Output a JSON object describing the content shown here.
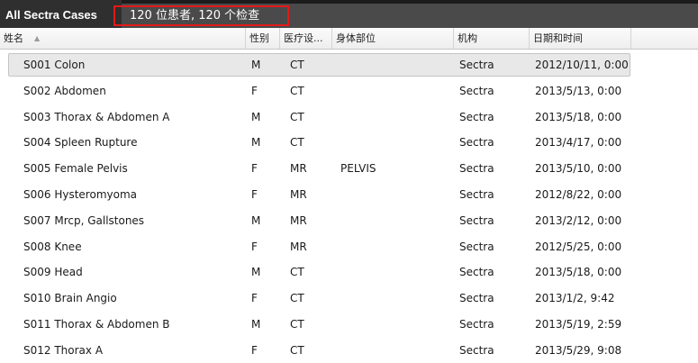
{
  "app": {
    "title": "All Sectra Cases",
    "case_count": "120 位患者, 120 个检查"
  },
  "columns": [
    {
      "key": "name",
      "label": "姓名"
    },
    {
      "key": "sex",
      "label": "性别"
    },
    {
      "key": "modality",
      "label": "医疗设..."
    },
    {
      "key": "body_part",
      "label": "身体部位"
    },
    {
      "key": "institution",
      "label": "机构"
    },
    {
      "key": "datetime",
      "label": "日期和时间"
    }
  ],
  "sort": {
    "column": "name",
    "direction": "ascending",
    "icon": "sort-ascending-icon"
  },
  "rows": [
    {
      "name": "S001 Colon",
      "sex": "M",
      "modality": "CT",
      "body_part": "",
      "institution": "Sectra",
      "datetime": "2012/10/11, 0:00",
      "selected": true
    },
    {
      "name": "S002 Abdomen",
      "sex": "F",
      "modality": "CT",
      "body_part": "",
      "institution": "Sectra",
      "datetime": "2013/5/13, 0:00"
    },
    {
      "name": "S003 Thorax & Abdomen A",
      "sex": "M",
      "modality": "CT",
      "body_part": "",
      "institution": "Sectra",
      "datetime": "2013/5/18, 0:00"
    },
    {
      "name": "S004 Spleen Rupture",
      "sex": "M",
      "modality": "CT",
      "body_part": "",
      "institution": "Sectra",
      "datetime": "2013/4/17, 0:00"
    },
    {
      "name": "S005 Female Pelvis",
      "sex": "F",
      "modality": "MR",
      "body_part": "PELVIS",
      "institution": "Sectra",
      "datetime": "2013/5/10, 0:00"
    },
    {
      "name": "S006 Hysteromyoma",
      "sex": "F",
      "modality": "MR",
      "body_part": "",
      "institution": "Sectra",
      "datetime": "2012/8/22, 0:00"
    },
    {
      "name": "S007 Mrcp, Gallstones",
      "sex": "M",
      "modality": "MR",
      "body_part": "",
      "institution": "Sectra",
      "datetime": "2013/2/12, 0:00"
    },
    {
      "name": "S008 Knee",
      "sex": "F",
      "modality": "MR",
      "body_part": "",
      "institution": "Sectra",
      "datetime": "2012/5/25, 0:00"
    },
    {
      "name": "S009 Head",
      "sex": "M",
      "modality": "CT",
      "body_part": "",
      "institution": "Sectra",
      "datetime": "2013/5/18, 0:00"
    },
    {
      "name": "S010 Brain Angio",
      "sex": "F",
      "modality": "CT",
      "body_part": "",
      "institution": "Sectra",
      "datetime": "2013/1/2, 9:42"
    },
    {
      "name": "S011 Thorax & Abdomen B",
      "sex": "M",
      "modality": "CT",
      "body_part": "",
      "institution": "Sectra",
      "datetime": "2013/5/19, 2:59"
    },
    {
      "name": "S012 Thorax A",
      "sex": "F",
      "modality": "CT",
      "body_part": "",
      "institution": "Sectra",
      "datetime": "2013/5/29, 9:08"
    }
  ],
  "colors": {
    "highlight_box": "#e21a1a",
    "title_bar": "#4a4a4a",
    "selected_row": "#e8e8e8"
  }
}
